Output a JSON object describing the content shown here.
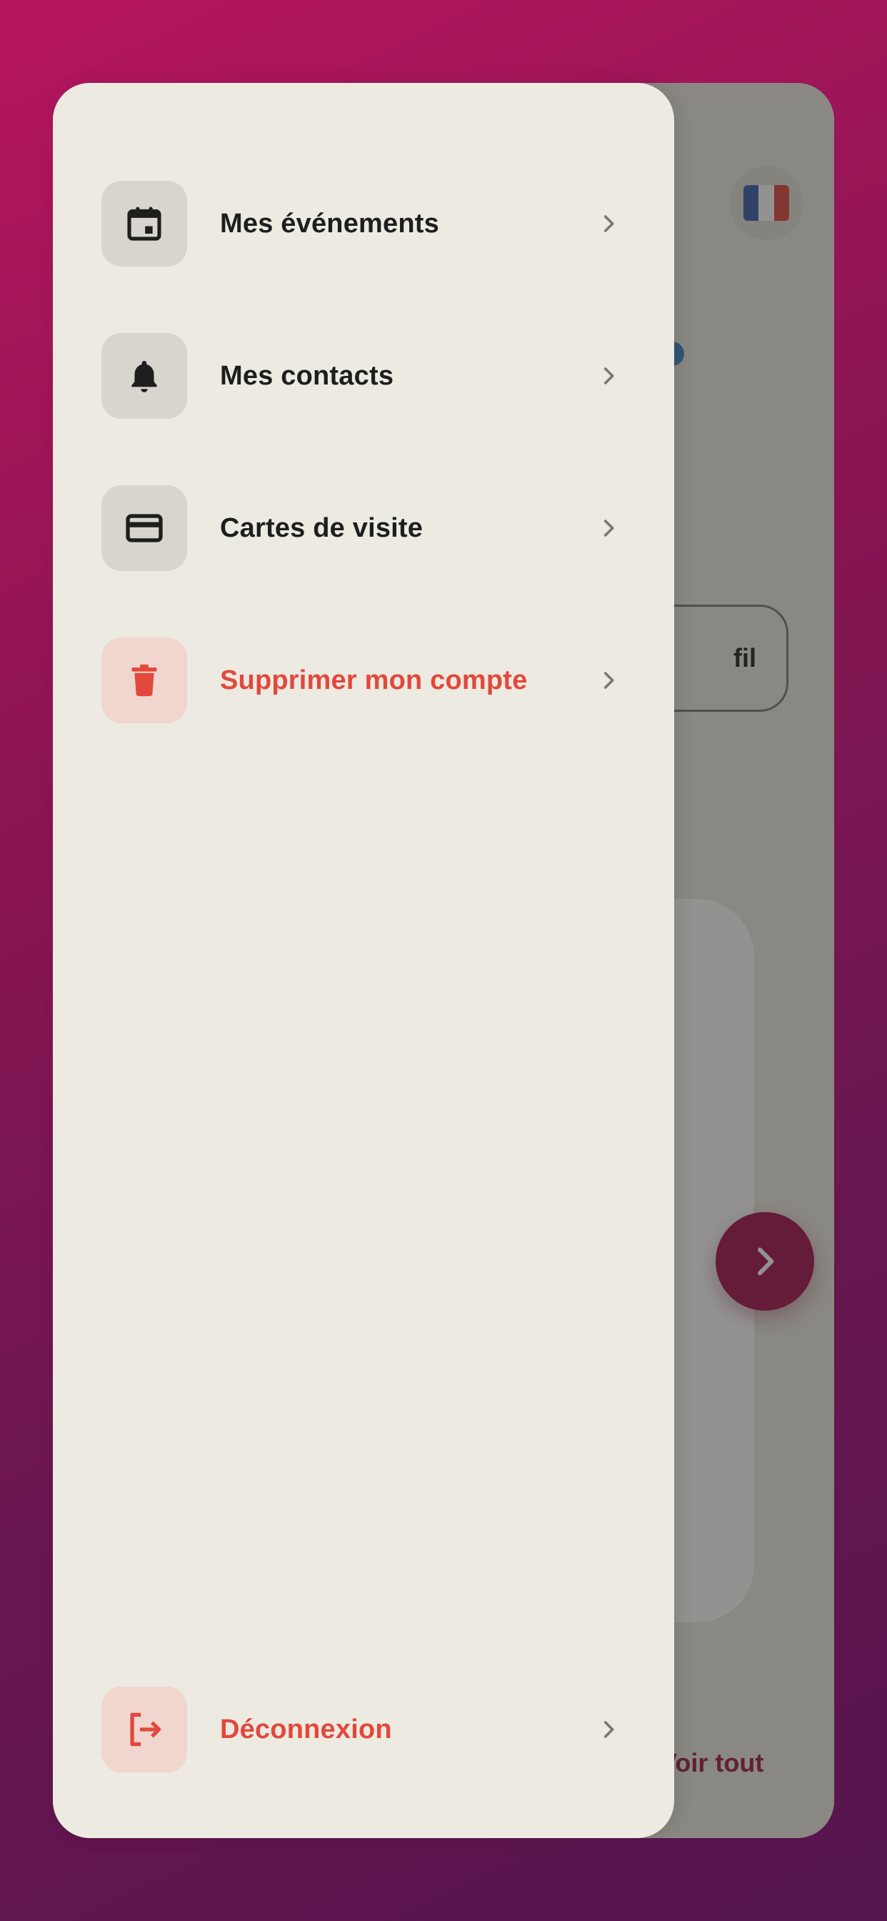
{
  "background_screen": {
    "profile_button_label": "fil",
    "see_all_label": "Voir tout",
    "language_flag": "france-flag-icon"
  },
  "drawer": {
    "items": [
      {
        "label": "Mes événements",
        "icon": "calendar-icon",
        "tone": "default"
      },
      {
        "label": "Mes contacts",
        "icon": "bell-icon",
        "tone": "default"
      },
      {
        "label": "Cartes de visite",
        "icon": "credit-card-icon",
        "tone": "default"
      },
      {
        "label": "Supprimer mon compte",
        "icon": "trash-icon",
        "tone": "danger"
      }
    ],
    "logout": {
      "label": "Déconnexion",
      "icon": "logout-icon",
      "tone": "danger"
    }
  },
  "colors": {
    "background_gradient_start": "#b5155f",
    "background_gradient_end": "#55154d",
    "drawer_background": "#eceae1",
    "icon_box_default": "#d7d5cd",
    "icon_box_danger": "#f0d6cf",
    "danger_text": "#e2483c",
    "accent": "#a2124d"
  }
}
